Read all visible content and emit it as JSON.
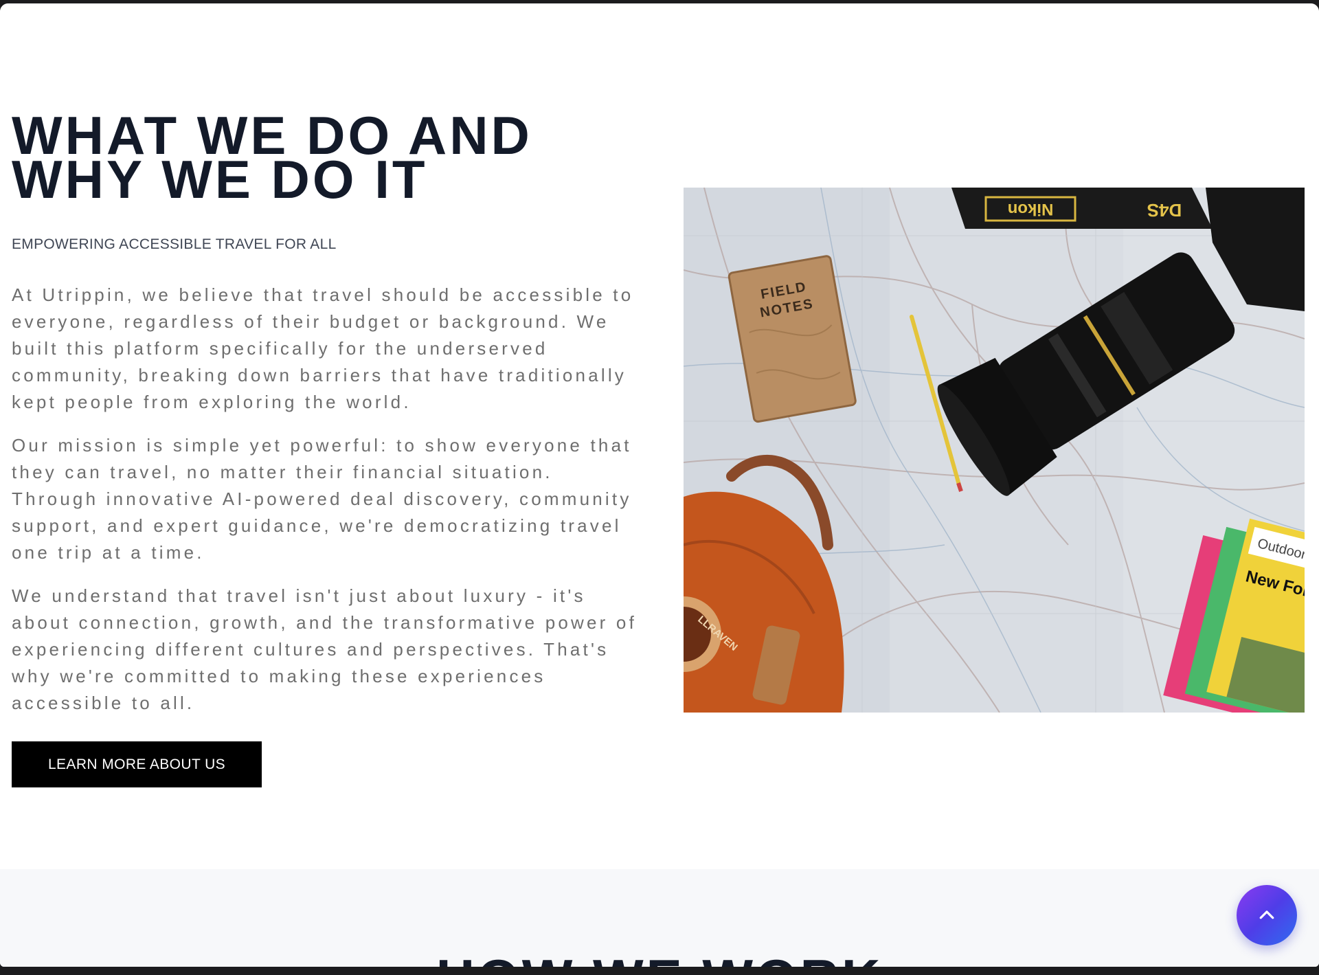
{
  "about": {
    "heading_line1": "WHAT WE DO AND",
    "heading_line2": "WHY WE DO IT",
    "subtitle": "EMPOWERING ACCESSIBLE TRAVEL FOR ALL",
    "paragraphs": [
      "At Utrippin, we believe that travel should be accessible to everyone, regardless of their budget or background. We built this platform specifically for the underserved community, breaking down barriers that have traditionally kept people from exploring the world.",
      "Our mission is simple yet powerful: to show everyone that they can travel, no matter their financial situation. Through innovative AI-powered deal discovery, community support, and expert guidance, we're democratizing travel one trip at a time.",
      "We understand that travel isn't just about luxury - it's about connection, growth, and the transformative power of experiencing different cultures and perspectives. That's why we're committed to making these experiences accessible to all."
    ],
    "cta_label": "LEARN MORE ABOUT US"
  },
  "photo": {
    "notebook_line1": "FIELD",
    "notebook_line2": "NOTES",
    "strap_brand": "Nikon",
    "strap_model": "D4S",
    "map_marks": "NEW FOREST",
    "guide_title": "New Fore",
    "guide_publisher": "Outdoor Le",
    "badge_text": "LLRAVEN"
  },
  "how": {
    "title": "HOW WE WORK"
  },
  "scroll_top": {
    "icon": "chevron-up-icon"
  },
  "colors": {
    "heading": "#131a29",
    "body_text": "#6e6e6e",
    "cta_bg": "#000000",
    "section_alt_bg": "#f7f8fa",
    "scroll_gradient_start": "#8b3cf0",
    "scroll_gradient_end": "#2f6cf0"
  }
}
